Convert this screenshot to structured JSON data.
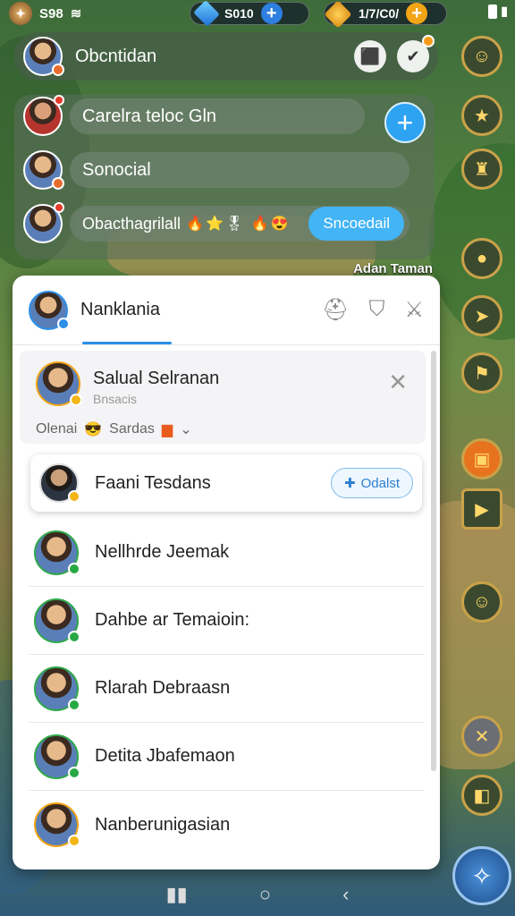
{
  "status_bar": {
    "time": "S98",
    "gems": "S010",
    "coins": "1/7/C0/",
    "plus": "+"
  },
  "header": {
    "title": "Obcntidan"
  },
  "chat_rows": [
    {
      "text": "Carelra teloc Gln",
      "action": "+"
    },
    {
      "text": "Sonocial"
    },
    {
      "text": "Obacthagrilall",
      "emojis": "🔥⭐🎖 🔥😍",
      "action": "Sncoedail"
    }
  ],
  "floating_label": "Adan Taman",
  "panel": {
    "title": "Nanklania",
    "profile": {
      "name": "Salual Selranan",
      "subtitle": "Bnsacis",
      "tag1": "Olenai",
      "tag2": "Sardas"
    },
    "highlight": {
      "name": "Faani Tesdans",
      "button": "Odalst"
    },
    "friends": [
      "Nellhrde Jeemak",
      "Dahbe ar Temaioin:",
      "Rlarah Debraasn",
      "Detita Jbafemaon",
      "Nanberunigasian"
    ]
  }
}
